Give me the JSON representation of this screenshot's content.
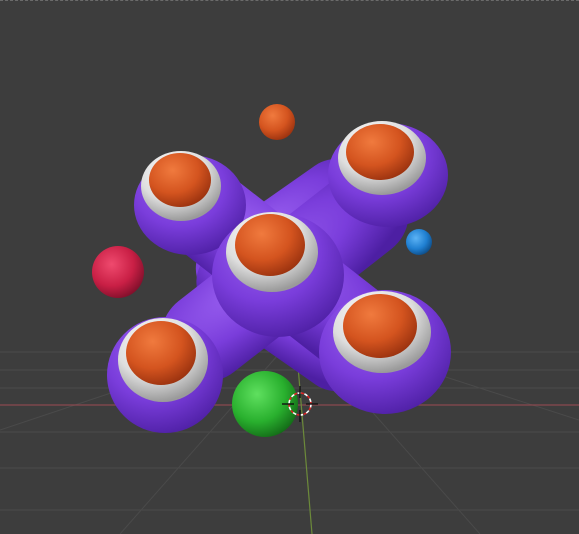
{
  "viewport": {
    "background_color": "#3d3d3d",
    "grid_color": "#4a4a4a",
    "x_axis_color": "#8a4a4f",
    "y_axis_color": "#6c8a3a"
  },
  "scene": {
    "spinner_body_color": "#7b3fd6",
    "cap_orange_color": "#d4541f",
    "cap_ring_color": "#e3e3e3",
    "spheres": [
      {
        "name": "red-sphere",
        "color": "#c91f45"
      },
      {
        "name": "orange-sphere",
        "color": "#d4541f"
      },
      {
        "name": "blue-sphere",
        "color": "#1f7fd1"
      },
      {
        "name": "green-sphere",
        "color": "#29b02e"
      }
    ]
  },
  "cursor_3d": {
    "icon": "3d-cursor-icon"
  }
}
